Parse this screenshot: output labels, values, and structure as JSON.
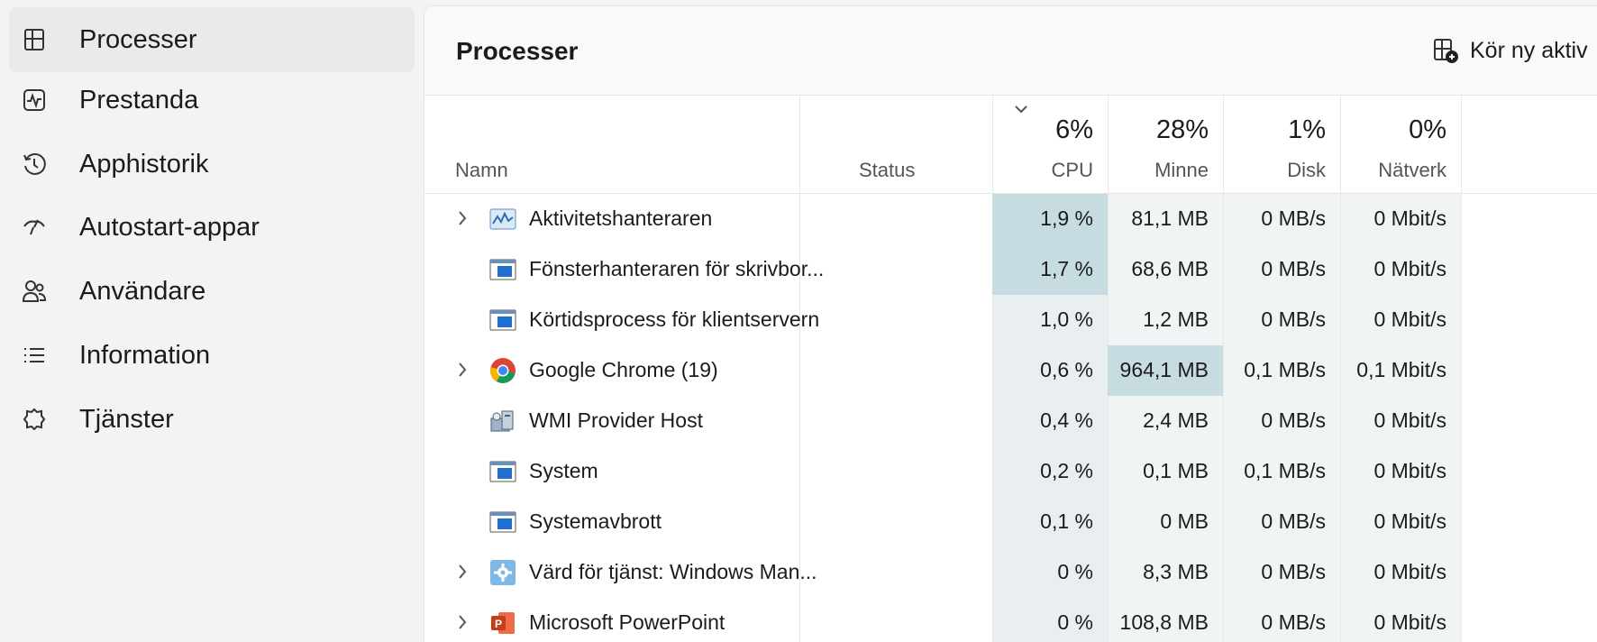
{
  "sidebar": {
    "items": [
      {
        "label": "Processer",
        "icon": "processes-icon",
        "active": true
      },
      {
        "label": "Prestanda",
        "icon": "performance-icon"
      },
      {
        "label": "Apphistorik",
        "icon": "history-icon"
      },
      {
        "label": "Autostart-appar",
        "icon": "startup-icon"
      },
      {
        "label": "Användare",
        "icon": "users-icon"
      },
      {
        "label": "Information",
        "icon": "details-icon"
      },
      {
        "label": "Tjänster",
        "icon": "services-icon"
      }
    ]
  },
  "header": {
    "title": "Processer",
    "run_task_label": "Kör ny aktiv"
  },
  "table": {
    "col_name": "Namn",
    "col_status": "Status",
    "metrics": [
      {
        "pct": "6%",
        "label": "CPU"
      },
      {
        "pct": "28%",
        "label": "Minne"
      },
      {
        "pct": "1%",
        "label": "Disk"
      },
      {
        "pct": "0%",
        "label": "Nätverk"
      }
    ],
    "rows": [
      {
        "name": "Aktivitetshanteraren",
        "icon": "task-manager-icon",
        "expandable": true,
        "cpu": "1,9 %",
        "mem": "81,1 MB",
        "disk": "0 MB/s",
        "net": "0 Mbit/s"
      },
      {
        "name": "Fönsterhanteraren för skrivbor...",
        "icon": "window-app-icon",
        "expandable": false,
        "cpu": "1,7 %",
        "mem": "68,6 MB",
        "disk": "0 MB/s",
        "net": "0 Mbit/s"
      },
      {
        "name": "Körtidsprocess för klientservern",
        "icon": "window-app-icon",
        "expandable": false,
        "cpu": "1,0 %",
        "mem": "1,2 MB",
        "disk": "0 MB/s",
        "net": "0 Mbit/s"
      },
      {
        "name": "Google Chrome (19)",
        "icon": "chrome-icon",
        "expandable": true,
        "cpu": "0,6 %",
        "mem": "964,1 MB",
        "disk": "0,1 MB/s",
        "net": "0,1 Mbit/s"
      },
      {
        "name": "WMI Provider Host",
        "icon": "wmi-icon",
        "expandable": false,
        "cpu": "0,4 %",
        "mem": "2,4 MB",
        "disk": "0 MB/s",
        "net": "0 Mbit/s"
      },
      {
        "name": "System",
        "icon": "window-app-icon",
        "expandable": false,
        "cpu": "0,2 %",
        "mem": "0,1 MB",
        "disk": "0,1 MB/s",
        "net": "0 Mbit/s"
      },
      {
        "name": "Systemavbrott",
        "icon": "window-app-icon",
        "expandable": false,
        "cpu": "0,1 %",
        "mem": "0 MB",
        "disk": "0 MB/s",
        "net": "0 Mbit/s"
      },
      {
        "name": "Värd för tjänst: Windows Man...",
        "icon": "service-host-icon",
        "expandable": true,
        "cpu": "0 %",
        "mem": "8,3 MB",
        "disk": "0 MB/s",
        "net": "0 Mbit/s"
      },
      {
        "name": "Microsoft PowerPoint",
        "icon": "powerpoint-icon",
        "expandable": true,
        "cpu": "0 %",
        "mem": "108,8 MB",
        "disk": "0 MB/s",
        "net": "0 Mbit/s"
      }
    ]
  }
}
